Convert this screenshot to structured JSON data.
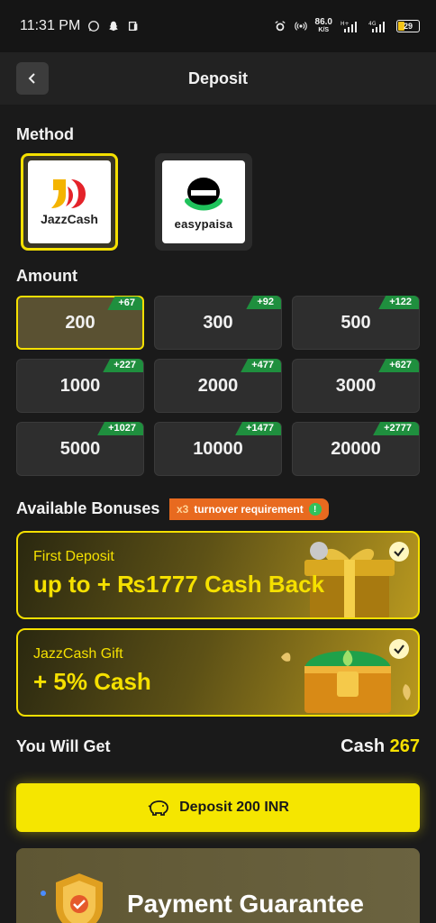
{
  "status_bar": {
    "time": "11:31 PM",
    "net_speed": "86.0",
    "net_unit": "K/S",
    "battery": "29"
  },
  "header": {
    "title": "Deposit"
  },
  "method": {
    "label": "Method",
    "options": [
      {
        "name": "JazzCash",
        "selected": true
      },
      {
        "name": "easypaisa",
        "selected": false
      }
    ]
  },
  "amount": {
    "label": "Amount",
    "options": [
      {
        "value": "200",
        "bonus": "+67",
        "selected": true
      },
      {
        "value": "300",
        "bonus": "+92"
      },
      {
        "value": "500",
        "bonus": "+122"
      },
      {
        "value": "1000",
        "bonus": "+227"
      },
      {
        "value": "2000",
        "bonus": "+477"
      },
      {
        "value": "3000",
        "bonus": "+627"
      },
      {
        "value": "5000",
        "bonus": "+1027"
      },
      {
        "value": "10000",
        "bonus": "+1477"
      },
      {
        "value": "20000",
        "bonus": "+2777"
      }
    ]
  },
  "bonuses": {
    "label": "Available Bonuses",
    "badge_multiplier": "x3",
    "badge_text": "turnover requirement",
    "cards": [
      {
        "title": "First Deposit",
        "headline": "up to  + ₨1777  Cash Back"
      },
      {
        "title": "JazzCash Gift",
        "headline": "+ 5%  Cash"
      }
    ]
  },
  "summary": {
    "label": "You Will Get",
    "currency_label": "Cash",
    "amount": "267"
  },
  "deposit_button": {
    "label": "Deposit 200 INR"
  },
  "guarantee": {
    "title": "Payment Guarantee"
  },
  "colors": {
    "accent": "#f5e000",
    "tag_green": "#1f8f3e",
    "badge_orange": "#e86a1f",
    "background": "#1a1a1a"
  }
}
